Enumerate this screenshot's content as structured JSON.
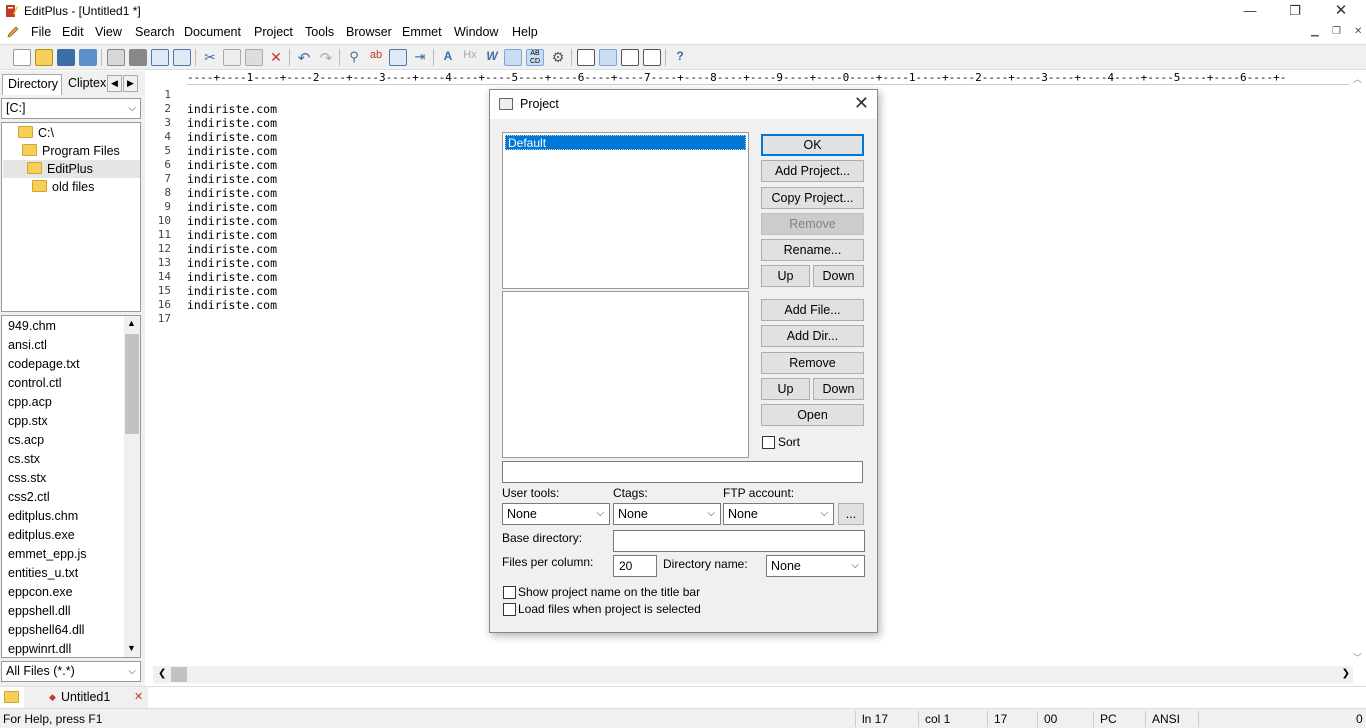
{
  "window": {
    "title": "EditPlus - [Untitled1 *]",
    "minimize": "—",
    "restore": "❐",
    "close": "✕"
  },
  "menu": [
    "File",
    "Edit",
    "View",
    "Search",
    "Document",
    "Project",
    "Tools",
    "Browser",
    "Emmet",
    "Window",
    "Help"
  ],
  "left_panel": {
    "tabs": [
      "Directory",
      "Cliptex"
    ],
    "drive": "[C:]",
    "tree": [
      "C:\\",
      "Program Files",
      "EditPlus",
      "old files"
    ],
    "files": [
      "949.chm",
      "ansi.ctl",
      "codepage.txt",
      "control.ctl",
      "cpp.acp",
      "cpp.stx",
      "cs.acp",
      "cs.stx",
      "css.stx",
      "css2.ctl",
      "editplus.chm",
      "editplus.exe",
      "emmet_epp.js",
      "entities_u.txt",
      "eppcon.exe",
      "eppshell.dll",
      "eppshell64.dll",
      "eppwinrt.dll"
    ],
    "filter": "All Files (*.*)"
  },
  "editor": {
    "ruler": "----+----1----+----2----+----3----+----4----+----5----+----6----+----7----+----8----+----9----+----0----+----1----+----2----+----3----+----4----+----5----+----6----+-",
    "lines": [
      "",
      "indiriste.com",
      "indiriste.com",
      "indiriste.com",
      "indiriste.com",
      "indiriste.com",
      "indiriste.com",
      "indiriste.com",
      "indiriste.com",
      "indiriste.com",
      "indiriste.com",
      "indiriste.com",
      "indiriste.com",
      "indiriste.com",
      "indiriste.com",
      "indiriste.com",
      ""
    ],
    "line_numbers": [
      "1",
      "2",
      "3",
      "4",
      "5",
      "6",
      "7",
      "8",
      "9",
      "10",
      "11",
      "12",
      "13",
      "14",
      "15",
      "16",
      "17"
    ]
  },
  "doc_tab": {
    "label": "Untitled1"
  },
  "status": {
    "help": "For Help, press F1",
    "ln": "ln 17",
    "col": "col 1",
    "num": "17",
    "hex": "00",
    "mode": "PC",
    "encoding": "ANSI",
    "last": "0"
  },
  "dialog": {
    "title": "Project",
    "projects": [
      "Default"
    ],
    "buttons": {
      "ok": "OK",
      "add_project": "Add Project...",
      "copy_project": "Copy Project...",
      "remove_project": "Remove",
      "rename": "Rename...",
      "up1": "Up",
      "down1": "Down",
      "add_file": "Add File...",
      "add_dir": "Add Dir...",
      "remove_file": "Remove",
      "up2": "Up",
      "down2": "Down",
      "open": "Open",
      "more": "..."
    },
    "sort_label": "Sort",
    "user_tools_label": "User tools:",
    "ctags_label": "Ctags:",
    "ftp_label": "FTP account:",
    "user_tools_value": "None",
    "ctags_value": "None",
    "ftp_value": "None",
    "base_dir_label": "Base directory:",
    "files_per_column_label": "Files per column:",
    "files_per_column_value": "20",
    "directory_name_label": "Directory name:",
    "directory_name_value": "None",
    "show_project_name": "Show project name on the title bar",
    "load_files": "Load files when project is selected"
  }
}
